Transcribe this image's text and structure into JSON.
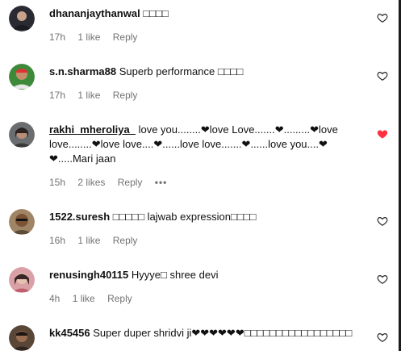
{
  "comments": [
    {
      "username": "dhananjaythanwal",
      "text": "□□□□",
      "time": "17h",
      "likes": "1 like",
      "reply": "Reply",
      "liked": false,
      "avatar_color": "#2a2a33"
    },
    {
      "username": "s.n.sharma88",
      "text": "Superb performance □□□□",
      "time": "17h",
      "likes": "1 like",
      "reply": "Reply",
      "liked": false,
      "avatar_color": "#3d8a3a"
    },
    {
      "username": "rakhi_mheroliya_",
      "text": "love you........❤love Love.......❤.........❤love love........❤love love....❤......love love.......❤......love you....❤❤.....Mari jaan",
      "time": "15h",
      "likes": "2 likes",
      "reply": "Reply",
      "more": "•••",
      "liked": true,
      "avatar_color": "#6b6e70"
    },
    {
      "username": "1522.suresh",
      "text": "□□□□□ lajwab expression□□□□",
      "time": "16h",
      "likes": "1 like",
      "reply": "Reply",
      "liked": false,
      "avatar_color": "#a08466"
    },
    {
      "username": "renusingh40115",
      "text": "Hyyye□ shree devi",
      "time": "4h",
      "likes": "1 like",
      "reply": "Reply",
      "liked": false,
      "avatar_color": "#d9a0a6"
    },
    {
      "username": "kk45456",
      "text": "Super duper shridvi ji❤❤❤❤❤❤□□□□□□□□□□□□□□□□□",
      "liked": false,
      "avatar_color": "#5a4636"
    }
  ],
  "colors": {
    "heart_liked": "#ff3040",
    "meta_text": "#737373"
  },
  "icons": {
    "like": "heart-outline-icon",
    "liked": "heart-filled-icon"
  }
}
